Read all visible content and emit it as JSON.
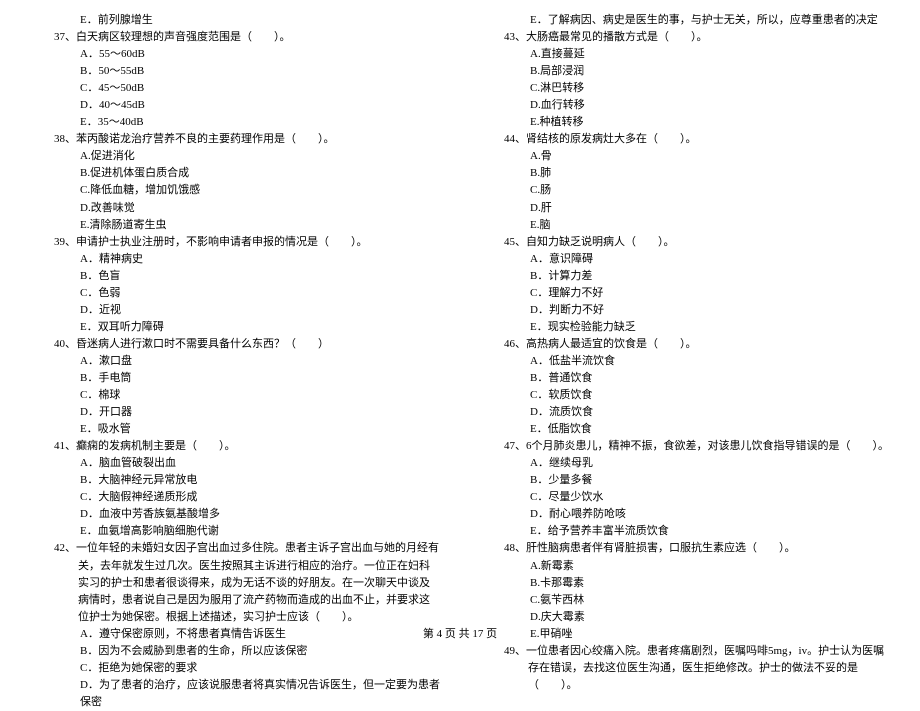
{
  "left": {
    "pre_option": "E．前列腺增生",
    "q37": {
      "stem": "37、白天病区较理想的声音强度范围是（　　）。",
      "opts": [
        "A．55～60dB",
        "B．50～55dB",
        "C．45～50dB",
        "D．40～45dB",
        "E．35～40dB"
      ]
    },
    "q38": {
      "stem": "38、苯丙酸诺龙治疗营养不良的主要药理作用是（　　）。",
      "opts": [
        "A.促进消化",
        "B.促进机体蛋白质合成",
        "C.降低血糖，增加饥饿感",
        "D.改善味觉",
        "E.清除肠道寄生虫"
      ]
    },
    "q39": {
      "stem": "39、申请护士执业注册时，不影响申请者申报的情况是（　　）。",
      "opts": [
        "A．精神病史",
        "B．色盲",
        "C．色弱",
        "D．近视",
        "E．双耳听力障碍"
      ]
    },
    "q40": {
      "stem": "40、昏迷病人进行漱口时不需要具备什么东西？（　　）",
      "opts": [
        "A．漱口盘",
        "B．手电筒",
        "C．棉球",
        "D．开口器",
        "E．吸水管"
      ]
    },
    "q41": {
      "stem": "41、癫痫的发病机制主要是（　　）。",
      "opts": [
        "A．脑血管破裂出血",
        "B．大脑神经元异常放电",
        "C．大脑假神经递质形成",
        "D．血液中芳香族氨基酸增多",
        "E．血氨增高影响脑细胞代谢"
      ]
    },
    "q42": {
      "stem": "42、一位年轻的未婚妇女因子宫出血过多住院。患者主诉子宫出血与她的月经有关，去年就发生过几次。医生按照其主诉进行相应的治疗。一位正在妇科实习的护士和患者很谈得来，成为无话不谈的好朋友。在一次聊天中谈及病情时，患者说自己是因为服用了流产药物而造成的出血不止，并要求这位护士为她保密。根据上述描述，实习护士应该（　　）。",
      "opts": [
        "A．遵守保密原则，不将患者真情告诉医生",
        "B．因为不会威胁到患者的生命，所以应该保密",
        "C．拒绝为她保密的要求",
        "D．为了患者的治疗，应该说服患者将真实情况告诉医生，但一定要为患者保密"
      ]
    }
  },
  "right": {
    "pre_option": "E．了解病因、病史是医生的事，与护士无关，所以，应尊重患者的决定",
    "q43": {
      "stem": "43、大肠癌最常见的播散方式是（　　）。",
      "opts": [
        "A.直接蔓延",
        "B.局部浸润",
        "C.淋巴转移",
        "D.血行转移",
        "E.种植转移"
      ]
    },
    "q44": {
      "stem": "44、肾结核的原发病灶大多在（　　）。",
      "opts": [
        "A.骨",
        "B.肺",
        "C.肠",
        "D.肝",
        "E.脑"
      ]
    },
    "q45": {
      "stem": "45、自知力缺乏说明病人（　　）。",
      "opts": [
        "A．意识障碍",
        "B．计算力差",
        "C．理解力不好",
        "D．判断力不好",
        "E．现实检验能力缺乏"
      ]
    },
    "q46": {
      "stem": "46、高热病人最适宜的饮食是（　　）。",
      "opts": [
        "A．低盐半流饮食",
        "B．普通饮食",
        "C．软质饮食",
        "D．流质饮食",
        "E．低脂饮食"
      ]
    },
    "q47": {
      "stem": "47、6个月肺炎患儿，精神不振，食欲差，对该患儿饮食指导错误的是（　　）。",
      "opts": [
        "A．继续母乳",
        "B．少量多餐",
        "C．尽量少饮水",
        "D．耐心喂养防呛咳",
        "E．给予营养丰富半流质饮食"
      ]
    },
    "q48": {
      "stem": "48、肝性脑病患者伴有肾脏损害，口服抗生素应选（　　）。",
      "opts": [
        "A.新霉素",
        "B.卡那霉素",
        "C.氨苄西林",
        "D.庆大霉素",
        "E.甲硝唑"
      ]
    },
    "q49": {
      "stem": "49、一位患者因心绞痛入院。患者疼痛剧烈，医嘱吗啡5mg，iv。护士认为医嘱存在错误，去找这位医生沟通，医生拒绝修改。护士的做法不妥的是（　　）。"
    }
  },
  "footer": "第 4 页 共 17 页"
}
